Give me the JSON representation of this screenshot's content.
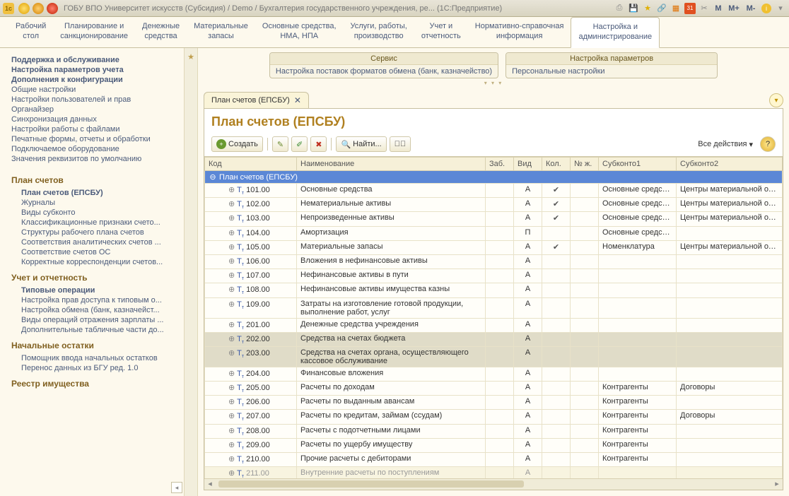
{
  "window": {
    "title": "ГОБУ ВПО Университет искусств (Субсидия) / Demo / Бухгалтерия государственного учреждения, ре...   (1С:Предприятие)",
    "m_buttons": [
      "M",
      "M+",
      "M-"
    ]
  },
  "nav_tabs": [
    {
      "label": "Рабочий\nстол"
    },
    {
      "label": "Планирование и\nсанкционирование"
    },
    {
      "label": "Денежные\nсредства"
    },
    {
      "label": "Материальные\nзапасы"
    },
    {
      "label": "Основные средства,\nНМА, НПА"
    },
    {
      "label": "Услуги, работы,\nпроизводство"
    },
    {
      "label": "Учет и\nотчетность"
    },
    {
      "label": "Нормативно-справочная\nинформация"
    },
    {
      "label": "Настройка и\nадминистрирование",
      "active": true
    }
  ],
  "service_boxes": [
    {
      "title": "Сервис",
      "rows": [
        "Настройка поставок форматов обмена (банк, казначейство)"
      ]
    },
    {
      "title": "Настройка параметров",
      "rows": [
        "Персональные настройки"
      ]
    }
  ],
  "sidebar": {
    "groups": [
      {
        "heading": null,
        "items": [
          {
            "label": "Поддержка и обслуживание",
            "bold": true
          },
          {
            "label": "Настройка параметров учета",
            "bold": true
          },
          {
            "label": "Дополнения к конфигурации",
            "bold": true
          }
        ]
      },
      {
        "heading": null,
        "items": [
          {
            "label": "Общие настройки"
          },
          {
            "label": "Настройки пользователей и прав"
          },
          {
            "label": "Органайзер"
          },
          {
            "label": "Синхронизация данных"
          },
          {
            "label": "Настройки работы с файлами"
          },
          {
            "label": "Печатные формы, отчеты и обработки"
          },
          {
            "label": "Подключаемое оборудование"
          },
          {
            "label": "Значения реквизитов по умолчанию"
          }
        ]
      },
      {
        "heading": "План счетов",
        "items": [
          {
            "label": "План счетов (ЕПСБУ)",
            "bold": true,
            "indent": true
          },
          {
            "label": "Журналы",
            "indent": true
          },
          {
            "label": "Виды субконто",
            "indent": true
          },
          {
            "label": "Классификационные признаки счето...",
            "indent": true
          },
          {
            "label": "Структуры рабочего плана счетов",
            "indent": true
          },
          {
            "label": "Соответствия аналитических счетов ...",
            "indent": true
          },
          {
            "label": "Соответствие счетов ОС",
            "indent": true
          },
          {
            "label": "Корректные корреспонденции счетов...",
            "indent": true
          }
        ]
      },
      {
        "heading": "Учет и отчетность",
        "items": [
          {
            "label": "Типовые операции",
            "bold": true,
            "indent": true
          },
          {
            "label": "Настройка прав доступа к типовым о...",
            "indent": true
          },
          {
            "label": "Настройка обмена (банк, казначейст...",
            "indent": true
          },
          {
            "label": "Виды операций отражения зарплаты ...",
            "indent": true
          },
          {
            "label": "Дополнительные табличные части до...",
            "indent": true
          }
        ]
      },
      {
        "heading": "Начальные остатки",
        "items": [
          {
            "label": "Помощник ввода начальных остатков",
            "indent": true
          },
          {
            "label": "Перенос данных из БГУ ред. 1.0",
            "indent": true
          }
        ]
      },
      {
        "heading": "Реестр имущества",
        "items": []
      }
    ]
  },
  "doc": {
    "tab_label": "План счетов (ЕПСБУ)",
    "title": "План счетов (ЕПСБУ)",
    "toolbar": {
      "create": "Создать",
      "find": "Найти...",
      "all_actions": "Все действия"
    },
    "columns": [
      "Код",
      "Наименование",
      "Заб.",
      "Вид",
      "Кол.",
      "№ ж.",
      "Субконто1",
      "Субконто2"
    ],
    "header_row": "План счетов (ЕПСБУ)",
    "rows": [
      {
        "code": "101.00",
        "name": "Основные средства",
        "vid": "А",
        "kol": true,
        "s1": "Основные средства",
        "s2": "Центры материальной отве"
      },
      {
        "code": "102.00",
        "name": "Нематериальные активы",
        "vid": "А",
        "kol": true,
        "s1": "Основные средства",
        "s2": "Центры материальной отве"
      },
      {
        "code": "103.00",
        "name": "Непроизведенные активы",
        "vid": "А",
        "kol": true,
        "s1": "Основные средства",
        "s2": "Центры материальной отве"
      },
      {
        "code": "104.00",
        "name": "Амортизация",
        "vid": "П",
        "s1": "Основные средства"
      },
      {
        "code": "105.00",
        "name": "Материальные запасы",
        "vid": "А",
        "kol": true,
        "s1": "Номенклатура",
        "s2": "Центры материальной отве"
      },
      {
        "code": "106.00",
        "name": "Вложения в нефинансовые активы",
        "vid": "А"
      },
      {
        "code": "107.00",
        "name": "Нефинансовые активы в пути",
        "vid": "А"
      },
      {
        "code": "108.00",
        "name": "Нефинансовые активы имущества казны",
        "vid": "А"
      },
      {
        "code": "109.00",
        "name": "Затраты на изготовление готовой продукции, выполнение работ, услуг",
        "vid": "А"
      },
      {
        "code": "201.00",
        "name": "Денежные средства учреждения",
        "vid": "А"
      },
      {
        "code": "202.00",
        "name": "Средства на счетах бюджета",
        "vid": "А",
        "grey": true
      },
      {
        "code": "203.00",
        "name": "Средства на счетах органа, осуществляющего кассовое обслуживание",
        "vid": "А",
        "grey": true
      },
      {
        "code": "204.00",
        "name": "Финансовые вложения",
        "vid": "А"
      },
      {
        "code": "205.00",
        "name": "Расчеты по доходам",
        "vid": "А",
        "s1": "Контрагенты",
        "s2": "Договоры"
      },
      {
        "code": "206.00",
        "name": "Расчеты по выданным авансам",
        "vid": "А",
        "s1": "Контрагенты"
      },
      {
        "code": "207.00",
        "name": "Расчеты по кредитам, займам (ссудам)",
        "vid": "А",
        "s1": "Контрагенты",
        "s2": "Договоры"
      },
      {
        "code": "208.00",
        "name": "Расчеты с подотчетными лицами",
        "vid": "А",
        "s1": "Контрагенты"
      },
      {
        "code": "209.00",
        "name": "Расчеты по ущербу имуществу",
        "vid": "А",
        "s1": "Контрагенты"
      },
      {
        "code": "210.00",
        "name": "Прочие расчеты с дебиторами",
        "vid": "А",
        "s1": "Контрагенты"
      },
      {
        "code": "211.00",
        "name": "Внутренние расчеты по поступлениям",
        "vid": "А",
        "cut": true
      }
    ]
  }
}
